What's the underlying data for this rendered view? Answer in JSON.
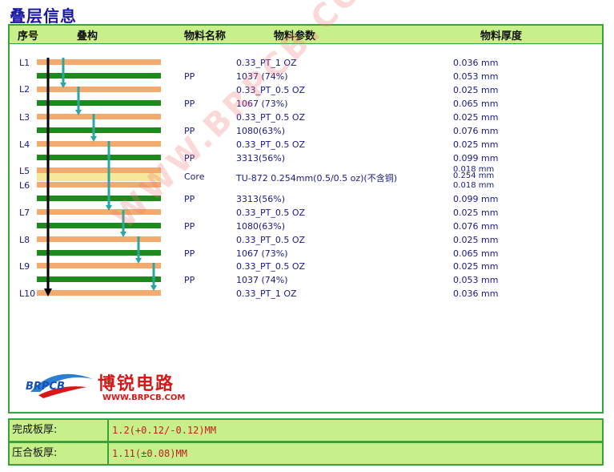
{
  "title": "叠层信息",
  "headers": {
    "seq": "序号",
    "stack": "叠构",
    "material_name": "物料名称",
    "material_param": "物料参数",
    "thickness": "物料厚度"
  },
  "layer_labels": [
    "L1",
    "L2",
    "L3",
    "L4",
    "L5",
    "L6",
    "L7",
    "L8",
    "L9",
    "L10"
  ],
  "rows": [
    {
      "name": "",
      "param": "0.33_PT_1 OZ",
      "thick": "0.036 mm"
    },
    {
      "name": "PP",
      "param": "1037 (74%)",
      "thick": "0.053 mm"
    },
    {
      "name": "",
      "param": "0.33_PT_0.5 OZ",
      "thick": "0.025 mm"
    },
    {
      "name": "PP",
      "param": "1067 (73%)",
      "thick": "0.065 mm"
    },
    {
      "name": "",
      "param": "0.33_PT_0.5 OZ",
      "thick": "0.025 mm"
    },
    {
      "name": "PP",
      "param": "1080(63%)",
      "thick": "0.076 mm"
    },
    {
      "name": "",
      "param": "0.33_PT_0.5 OZ",
      "thick": "0.025 mm"
    },
    {
      "name": "PP",
      "param": "3313(56%)",
      "thick": "0.099 mm"
    },
    {
      "name": "",
      "param": "",
      "thick": "0.018 mm"
    },
    {
      "name": "Core",
      "param": "TU-872 0.254mm(0.5/0.5 oz)(不含铜)",
      "thick": "0.254 mm"
    },
    {
      "name": "",
      "param": "",
      "thick": "0.018 mm"
    },
    {
      "name": "PP",
      "param": "3313(56%)",
      "thick": "0.099 mm"
    },
    {
      "name": "",
      "param": "0.33_PT_0.5 OZ",
      "thick": "0.025 mm"
    },
    {
      "name": "PP",
      "param": "1080(63%)",
      "thick": "0.076 mm"
    },
    {
      "name": "",
      "param": "0.33_PT_0.5 OZ",
      "thick": "0.025 mm"
    },
    {
      "name": "PP",
      "param": "1067 (73%)",
      "thick": "0.065 mm"
    },
    {
      "name": "",
      "param": "0.33_PT_0.5 OZ",
      "thick": "0.025 mm"
    },
    {
      "name": "PP",
      "param": "1037 (74%)",
      "thick": "0.053 mm"
    },
    {
      "name": "",
      "param": "0.33_PT_1 OZ",
      "thick": "0.036 mm"
    }
  ],
  "watermark": "WWW.BRPCB.COM",
  "logo": {
    "cn": "博锐电路",
    "en": "BRPCB",
    "url": "WWW.BRPCB.COM"
  },
  "summary": {
    "finished_label": "完成板厚:",
    "finished_value": "1.2(+0.12/-0.12)MM",
    "pressed_label": "压合板厚:",
    "pressed_value": "1.11(±0.08)MM"
  },
  "colors": {
    "copper": "#f2aa6e",
    "prepreg": "#1e8a1e",
    "core": "#f6e89a",
    "arrow": "#2aa8a0",
    "header_bg": "#c8f08a",
    "border": "#3aa23a"
  }
}
